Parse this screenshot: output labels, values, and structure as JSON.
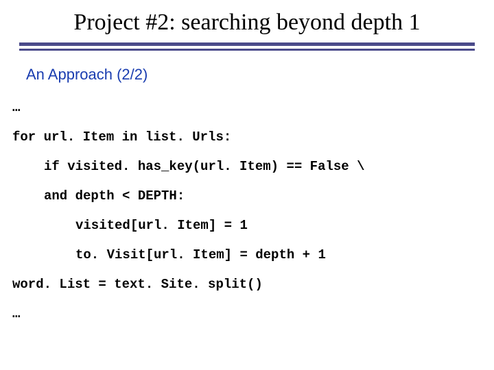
{
  "title": "Project #2: searching beyond depth 1",
  "subtitle": "An Approach (2/2)",
  "code": {
    "l0": "…",
    "l1": "for url. Item in list. Urls:",
    "l2": "if visited. has_key(url. Item) == False \\",
    "l3": "and depth < DEPTH:",
    "l4": "visited[url. Item] = 1",
    "l5": "to. Visit[url. Item] = depth + 1",
    "l6": "word. List = text. Site. split()",
    "l7": "…"
  }
}
